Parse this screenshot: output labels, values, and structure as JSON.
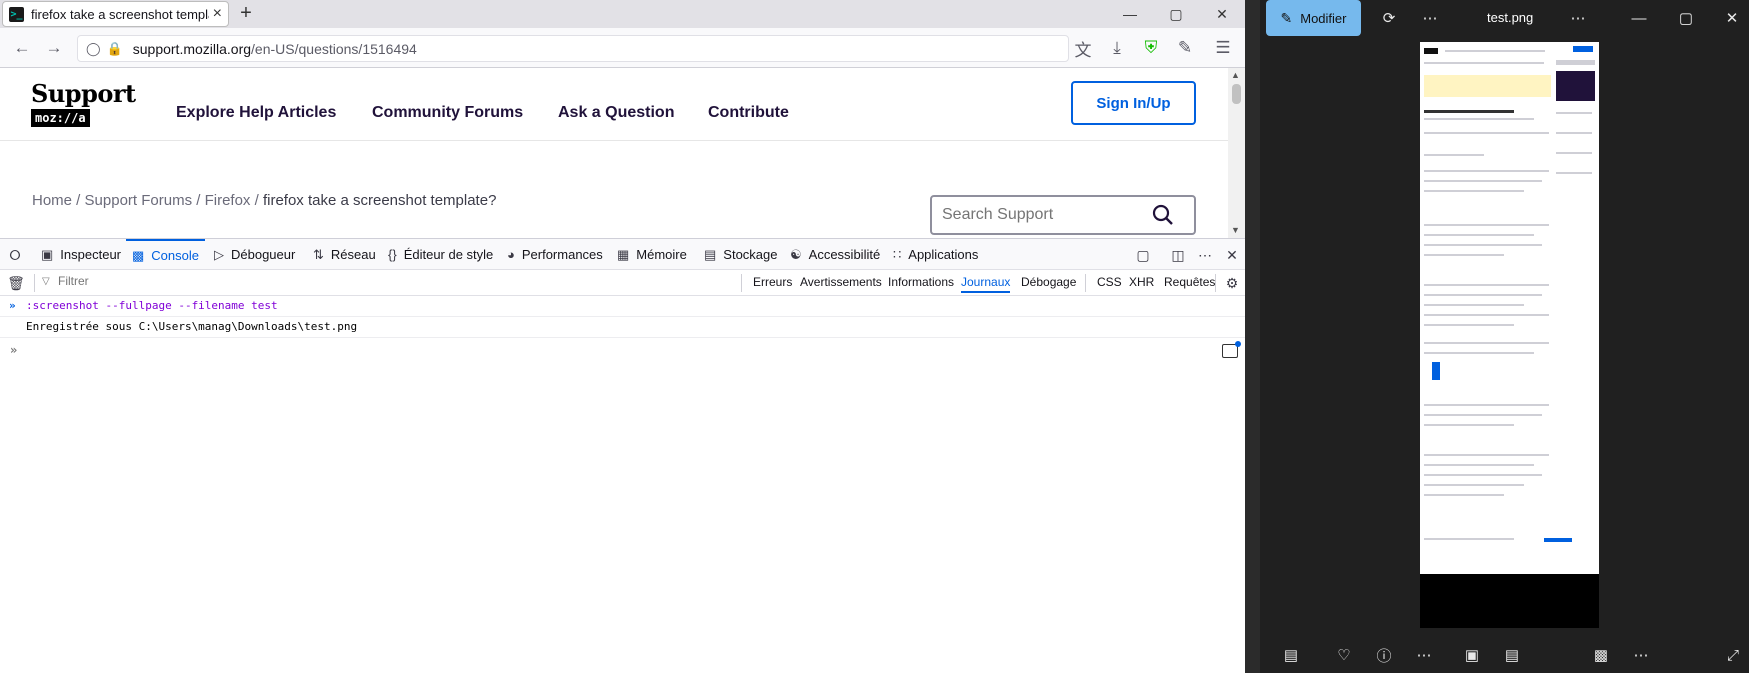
{
  "browser": {
    "tab_title": "firefox take a screenshot template?",
    "tab_close": "×",
    "new_tab": "+",
    "url_host": "support.mozilla.org",
    "url_path": "/en-US/questions/1516494"
  },
  "page": {
    "logo_top": "Support",
    "logo_bottom": "moz://a",
    "nav": [
      "Explore Help Articles",
      "Community Forums",
      "Ask a Question",
      "Contribute"
    ],
    "signin": "Sign In/Up",
    "breadcrumb": {
      "home": "Home",
      "forums": "Support Forums",
      "firefox": "Firefox",
      "current": "firefox take a screenshot template?",
      "sep": " / "
    },
    "search_placeholder": "Search Support"
  },
  "devtools": {
    "tabs": [
      "Inspecteur",
      "Console",
      "Débogueur",
      "Réseau",
      "Éditeur de style",
      "Performances",
      "Mémoire",
      "Stockage",
      "Accessibilité",
      "Applications"
    ],
    "active_tab": "Console",
    "filter_placeholder": "Filtrer",
    "levels": [
      "Erreurs",
      "Avertissements",
      "Informations",
      "Journaux",
      "Débogage"
    ],
    "active_level": "Journaux",
    "request_types": [
      "CSS",
      "XHR",
      "Requêtes"
    ],
    "command": ":screenshot --fullpage --filename test",
    "result": "Enregistrée sous C:\\Users\\manag\\Downloads\\test.png"
  },
  "photos": {
    "edit_button": "Modifier",
    "file_name": "test.png"
  },
  "colors": {
    "accent": "#0060df",
    "photos_accent": "#76b9ed",
    "command": "#8000d7"
  }
}
